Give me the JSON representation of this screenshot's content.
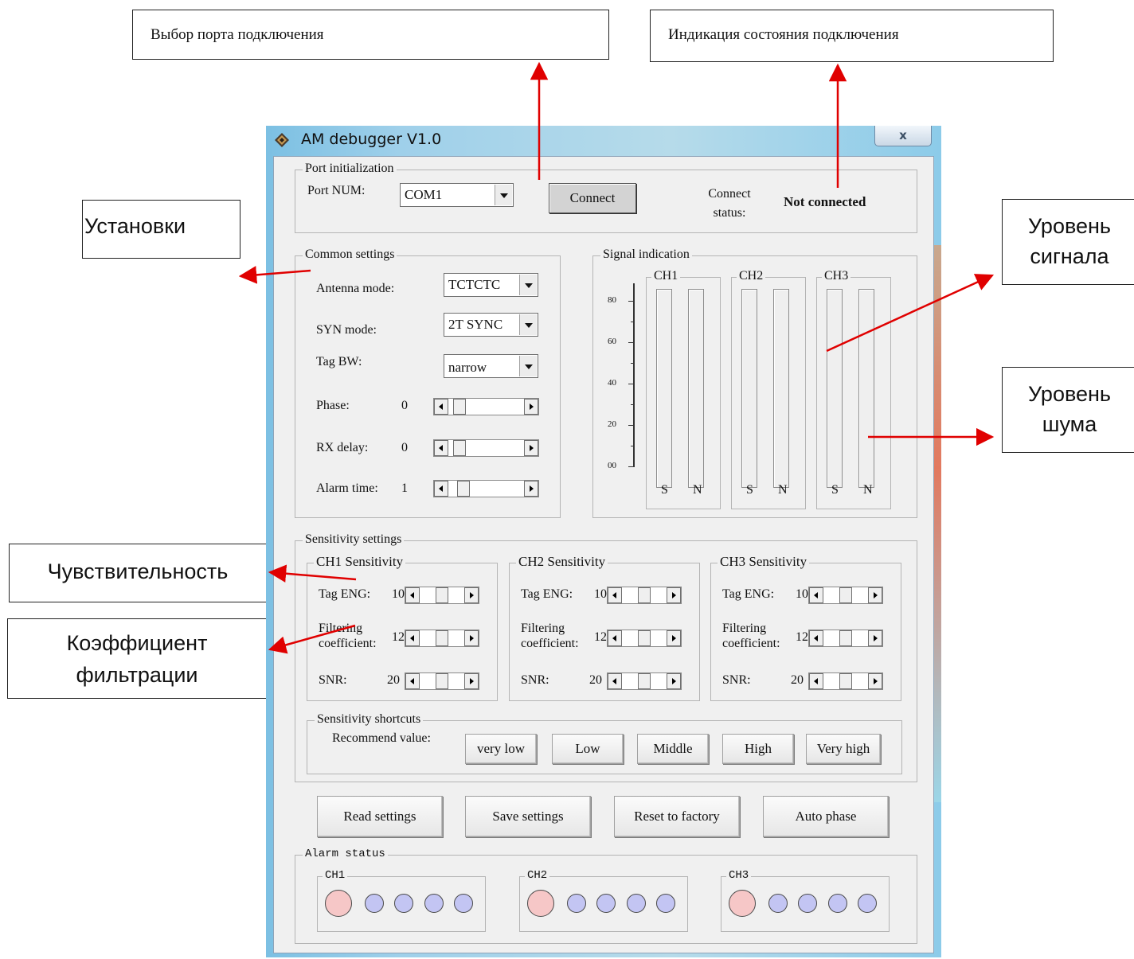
{
  "callouts": {
    "port_select": "Выбор порта подключения",
    "connect_state": "Индикация состояния подключения",
    "settings": "Установки",
    "signal_level": "Уровень сигнала",
    "noise_level": "Уровень шума",
    "sensitivity": "Чувствительность",
    "filter_coef": "Коэффициент фильтрации"
  },
  "window": {
    "title": "AM debugger V1.0",
    "close": "x"
  },
  "port": {
    "group": "Port initialization",
    "port_num_label": "Port NUM:",
    "port_value": "COM1",
    "connect_button": "Connect",
    "status_label": "Connect status:",
    "status_value": "Not connected"
  },
  "common": {
    "group": "Common settings",
    "antenna_label": "Antenna mode:",
    "antenna_value": "TCTCTC",
    "syn_label": "SYN mode:",
    "syn_value": "2T SYNC",
    "tagbw_label": "Tag BW:",
    "tagbw_value": "narrow",
    "phase_label": "Phase:",
    "phase_value": "0",
    "rxdelay_label": "RX delay:",
    "rxdelay_value": "0",
    "alarm_label": "Alarm time:",
    "alarm_value": "1"
  },
  "signal": {
    "group": "Signal indication",
    "scale": [
      "80",
      "60",
      "40",
      "20",
      "00"
    ],
    "channels": [
      {
        "name": "CH1",
        "s_label": "S",
        "n_label": "N",
        "s_level": 0,
        "n_level": 0
      },
      {
        "name": "CH2",
        "s_label": "S",
        "n_label": "N",
        "s_level": 0,
        "n_level": 0
      },
      {
        "name": "CH3",
        "s_label": "S",
        "n_label": "N",
        "s_level": 0,
        "n_level": 0
      }
    ]
  },
  "sensitivity": {
    "group": "Sensitivity settings",
    "channels": [
      {
        "title": "CH1 Sensitivity",
        "tag_label": "Tag ENG:",
        "tag_value": "10",
        "filt_label1": "Filtering",
        "filt_label2": "coefficient:",
        "filt_value": "12",
        "snr_label": "SNR:",
        "snr_value": "20"
      },
      {
        "title": "CH2 Sensitivity",
        "tag_label": "Tag ENG:",
        "tag_value": "10",
        "filt_label1": "Filtering",
        "filt_label2": "coefficient:",
        "filt_value": "12",
        "snr_label": "SNR:",
        "snr_value": "20"
      },
      {
        "title": "CH3 Sensitivity",
        "tag_label": "Tag ENG:",
        "tag_value": "10",
        "filt_label1": "Filtering",
        "filt_label2": "coefficient:",
        "filt_value": "12",
        "snr_label": "SNR:",
        "snr_value": "20"
      }
    ],
    "shortcuts_group": "Sensitivity shortcuts",
    "recommend_label": "Recommend value:",
    "presets": [
      "very low",
      "Low",
      "Middle",
      "High",
      "Very high"
    ]
  },
  "actions": {
    "read": "Read settings",
    "save": "Save settings",
    "reset": "Reset to factory",
    "auto_phase": "Auto phase"
  },
  "alarm": {
    "group": "Alarm status",
    "channels": [
      "CH1",
      "CH2",
      "CH3"
    ]
  },
  "colors": {
    "alarm_active": "#f6c7c7",
    "alarm_idle": "#c3c5f3",
    "arrow": "#e00000"
  }
}
